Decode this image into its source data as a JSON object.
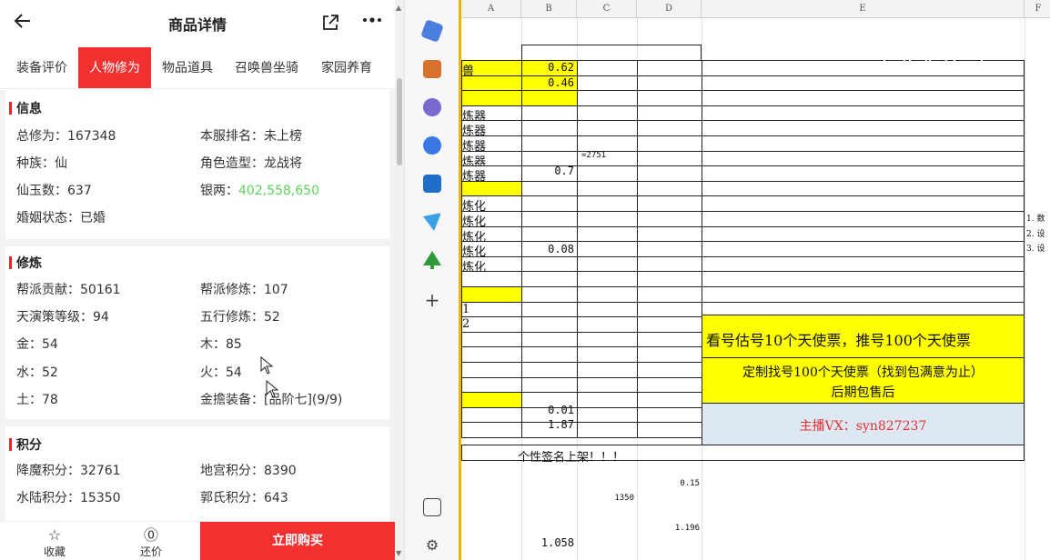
{
  "phone": {
    "header": {
      "title": "商品详情"
    },
    "tabs": [
      "装备评价",
      "人物修为",
      "物品道具",
      "召唤兽坐骑",
      "家园养育"
    ],
    "active_tab": 1,
    "sections": {
      "info": {
        "title": "信息",
        "rows": [
          [
            {
              "k": "总修为：",
              "v": "167348"
            },
            {
              "k": "本服排名：",
              "v": "未上榜"
            }
          ],
          [
            {
              "k": "种族：",
              "v": "仙"
            },
            {
              "k": "角色造型：",
              "v": "龙战将"
            }
          ],
          [
            {
              "k": "仙玉数：",
              "v": "637"
            },
            {
              "k": "银两：",
              "v": "402,558,650"
            }
          ],
          [
            {
              "k": "婚姻状态：",
              "v": "已婚"
            }
          ]
        ]
      },
      "cultivation": {
        "title": "修炼",
        "rows": [
          [
            {
              "k": "帮派贡献：",
              "v": "50161"
            },
            {
              "k": "帮派修炼：",
              "v": "107"
            }
          ],
          [
            {
              "k": "天演策等级：",
              "v": "94"
            },
            {
              "k": "五行修炼：",
              "v": "52"
            }
          ],
          [
            {
              "k": "金：",
              "v": "54"
            },
            {
              "k": "木：",
              "v": "85"
            }
          ],
          [
            {
              "k": "水：",
              "v": "52"
            },
            {
              "k": "火：",
              "v": "54"
            }
          ],
          [
            {
              "k": "土：",
              "v": "78"
            },
            {
              "k": "金擔装备：",
              "v": "[品阶七](9/9)"
            }
          ]
        ]
      },
      "points": {
        "title": "积分",
        "rows": [
          [
            {
              "k": "降魔积分：",
              "v": "32761"
            },
            {
              "k": "地宫积分：",
              "v": "8390"
            }
          ],
          [
            {
              "k": "水陆积分：",
              "v": "15350"
            },
            {
              "k": "郭氏积分：",
              "v": "643"
            }
          ]
        ]
      }
    },
    "bottom": {
      "favorite": "收藏",
      "bargain": "还价",
      "buy": "立即购买"
    },
    "colors": {
      "accent": "#f23030",
      "money_green": "#5bd35b"
    }
  },
  "sheet": {
    "columns": [
      "A",
      "B",
      "C",
      "D",
      "E",
      "F"
    ],
    "col_a_labels": [
      "兽",
      "",
      "",
      "炼器",
      "炼器",
      "炼器",
      "炼器",
      "炼器",
      "",
      "炼化",
      "炼化",
      "炼化",
      "炼化",
      "炼化",
      "",
      "",
      "1",
      "2",
      "",
      "",
      "",
      "",
      "",
      "",
      ""
    ],
    "values": {
      "b_row1": "0.62",
      "b_row2": "0.46",
      "c_row9": "=2751",
      "b_row10": "0.7",
      "b_row17": "0.08",
      "b_row28": "0.01",
      "b_row29": "1.87"
    },
    "banner1": "看号估号10个天使票，推号100个天使票",
    "banner2_line1": "定制找号100个天使票（找到包满意为止）",
    "banner2_line2": "后期包售后",
    "banner3": "主播VX：syn827237",
    "signature_row": "个性签名上架！！！",
    "notes_f": [
      "1. 数",
      "2. 设",
      "3. 设"
    ],
    "loose_values": [
      "0.15",
      "1350",
      "1.196",
      "1.058"
    ],
    "colors": {
      "yellow": "#ffff00",
      "blue_panel": "#dde8f3",
      "red_text": "#e03030",
      "frame": "#e8b800"
    }
  }
}
